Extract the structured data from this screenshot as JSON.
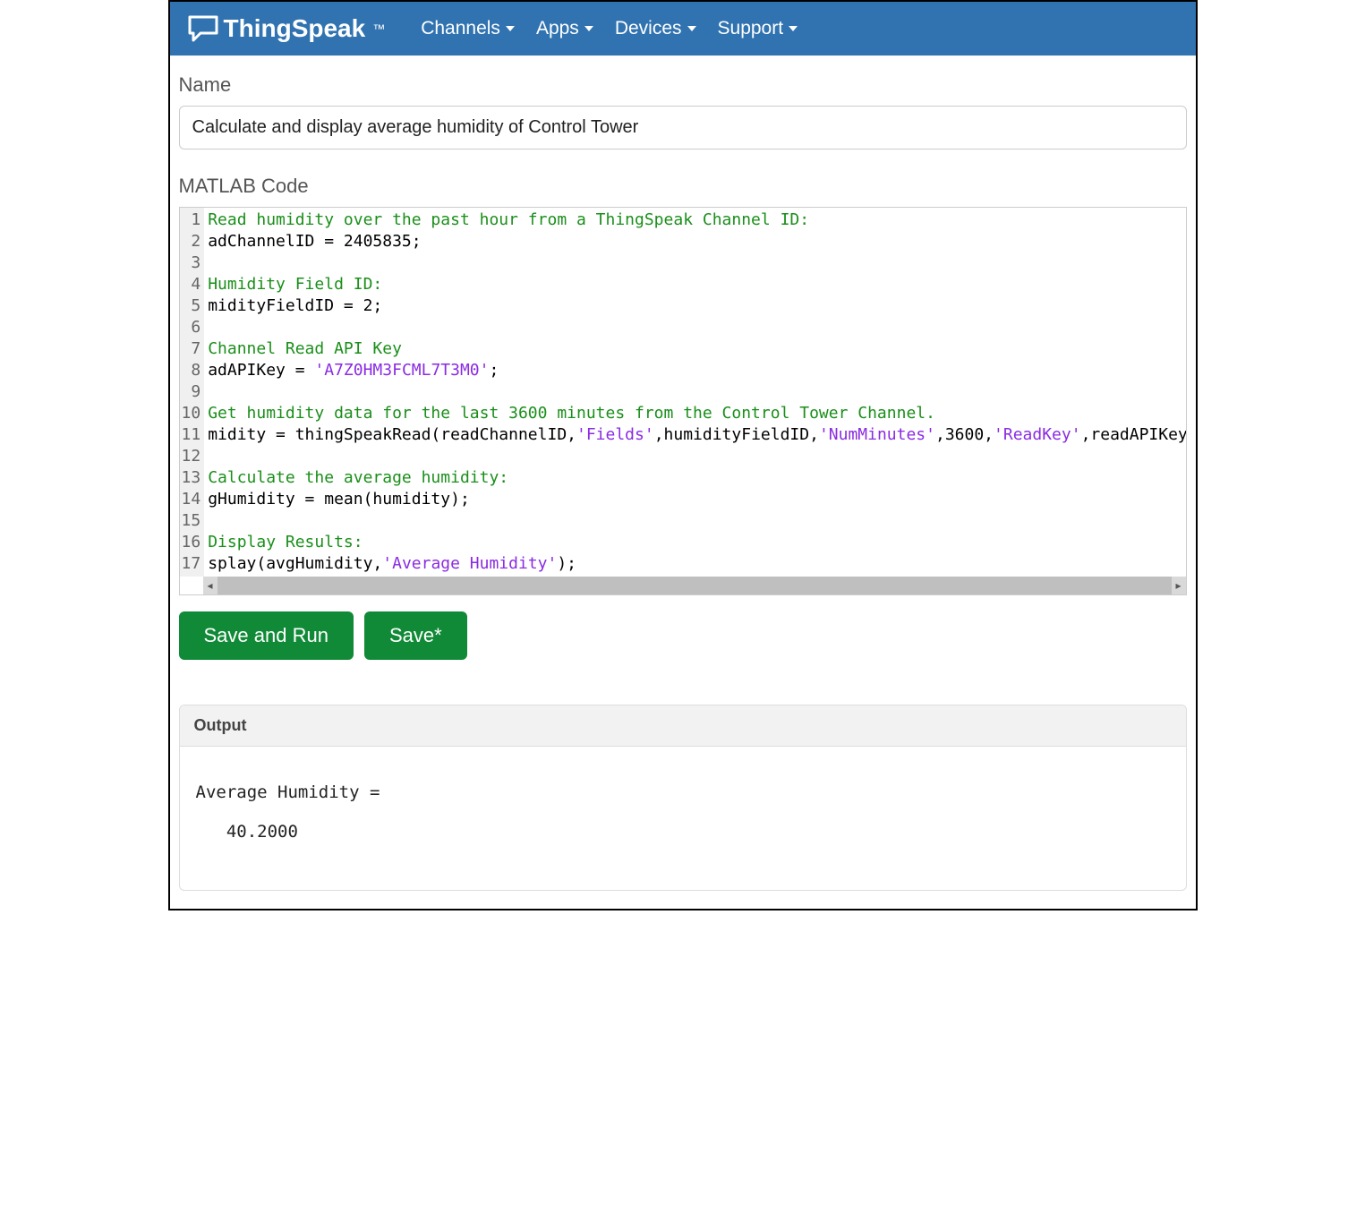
{
  "brand": "ThingSpeak",
  "trademark": "™",
  "nav": {
    "items": [
      {
        "label": "Channels"
      },
      {
        "label": "Apps"
      },
      {
        "label": "Devices"
      },
      {
        "label": "Support"
      }
    ]
  },
  "form": {
    "name_label": "Name",
    "name_value": "Calculate and display average humidity of Control Tower",
    "code_label": "MATLAB Code"
  },
  "code": {
    "lines": [
      {
        "n": 1,
        "segs": [
          {
            "t": "Read humidity over the past hour from a ThingSpeak Channel ID:",
            "c": "cm"
          }
        ]
      },
      {
        "n": 2,
        "segs": [
          {
            "t": "adChannelID = 2405835;",
            "c": ""
          }
        ]
      },
      {
        "n": 3,
        "segs": []
      },
      {
        "n": 4,
        "segs": [
          {
            "t": "Humidity Field ID:",
            "c": "cm"
          }
        ]
      },
      {
        "n": 5,
        "segs": [
          {
            "t": "midityFieldID = 2;",
            "c": ""
          }
        ]
      },
      {
        "n": 6,
        "segs": []
      },
      {
        "n": 7,
        "segs": [
          {
            "t": "Channel Read API Key",
            "c": "cm"
          }
        ]
      },
      {
        "n": 8,
        "segs": [
          {
            "t": "adAPIKey = ",
            "c": ""
          },
          {
            "t": "'A7Z0HM3FCML7T3M0'",
            "c": "str"
          },
          {
            "t": ";",
            "c": ""
          }
        ]
      },
      {
        "n": 9,
        "segs": []
      },
      {
        "n": 10,
        "segs": [
          {
            "t": "Get humidity data for the last 3600 minutes from the Control Tower Channel.",
            "c": "cm"
          }
        ]
      },
      {
        "n": 11,
        "segs": [
          {
            "t": "midity = thingSpeakRead(readChannelID,",
            "c": ""
          },
          {
            "t": "'Fields'",
            "c": "str"
          },
          {
            "t": ",humidityFieldID,",
            "c": ""
          },
          {
            "t": "'NumMinutes'",
            "c": "str"
          },
          {
            "t": ",3600,",
            "c": ""
          },
          {
            "t": "'ReadKey'",
            "c": "str"
          },
          {
            "t": ",readAPIKey);",
            "c": ""
          }
        ]
      },
      {
        "n": 12,
        "segs": []
      },
      {
        "n": 13,
        "segs": [
          {
            "t": "Calculate the average humidity:",
            "c": "cm"
          }
        ]
      },
      {
        "n": 14,
        "segs": [
          {
            "t": "gHumidity = mean(humidity);",
            "c": ""
          }
        ]
      },
      {
        "n": 15,
        "segs": []
      },
      {
        "n": 16,
        "segs": [
          {
            "t": "Display Results:",
            "c": "cm"
          }
        ]
      },
      {
        "n": 17,
        "segs": [
          {
            "t": "splay(avgHumidity,",
            "c": ""
          },
          {
            "t": "'Average Humidity'",
            "c": "str"
          },
          {
            "t": ");",
            "c": ""
          }
        ]
      }
    ]
  },
  "buttons": {
    "save_and_run": "Save and Run",
    "save": "Save*"
  },
  "output": {
    "header": "Output",
    "text": "Average Humidity =\n\n   40.2000"
  }
}
